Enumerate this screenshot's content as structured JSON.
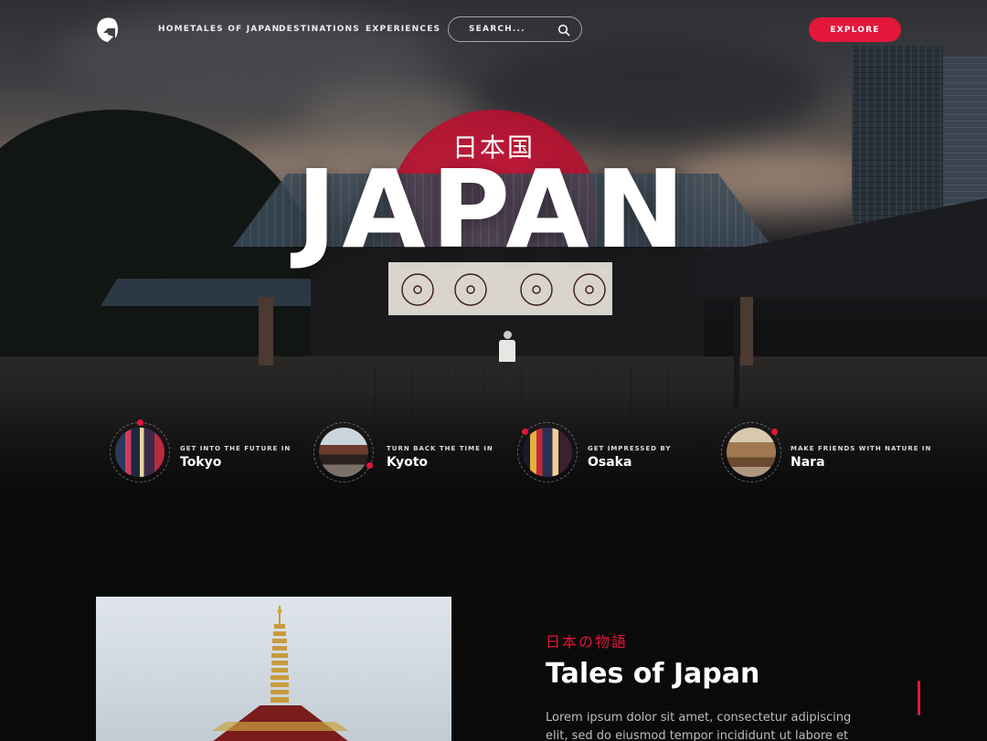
{
  "nav": {
    "logo_icon": "g-logo-icon",
    "links": [
      "HOMETALES OF JAPAN",
      "DESTINATIONS",
      "EXPERIENCES"
    ],
    "search_placeholder": "SEARCH...",
    "explore_label": "EXPLORE"
  },
  "hero": {
    "kanji": "日本国",
    "title": "JAPAN"
  },
  "cities": [
    {
      "kicker": "GET INTO THE FUTURE IN",
      "name": "Tokyo"
    },
    {
      "kicker": "TURN BACK THE TIME IN",
      "name": "Kyoto"
    },
    {
      "kicker": "GET IMPRESSED BY",
      "name": "Osaka"
    },
    {
      "kicker": "MAKE FRIENDS WITH NATURE IN",
      "name": "Nara"
    }
  ],
  "tales": {
    "jp_subtitle": "日本の物語",
    "title": "Tales of Japan",
    "body": "Lorem ipsum dolor sit amet, consectetur adipiscing elit, sed do eiusmod tempor incididunt ut labore et dolore magna"
  },
  "colors": {
    "accent": "#e2173a",
    "background": "#0b0a0b"
  }
}
